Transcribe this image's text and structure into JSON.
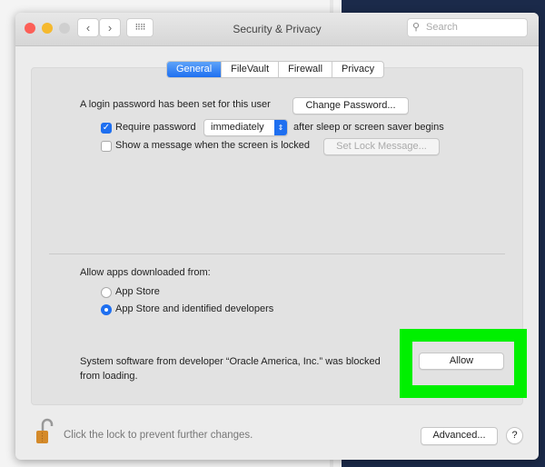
{
  "window": {
    "title": "Security & Privacy",
    "search_placeholder": "Search"
  },
  "tabs": [
    {
      "label": "General",
      "active": true
    },
    {
      "label": "FileVault"
    },
    {
      "label": "Firewall"
    },
    {
      "label": "Privacy"
    }
  ],
  "general": {
    "login_text": "A login password has been set for this user",
    "change_password": "Change Password...",
    "require_password_label": "Require password",
    "require_password_checked": true,
    "require_password_delay": "immediately",
    "after_sleep_text": "after sleep or screen saver begins",
    "show_message_label": "Show a message when the screen is locked",
    "show_message_checked": false,
    "set_lock_message": "Set Lock Message...",
    "allow_apps_label": "Allow apps downloaded from:",
    "options": [
      {
        "label": "App Store",
        "selected": false
      },
      {
        "label": "App Store and identified developers",
        "selected": true
      }
    ],
    "blocked_line1": "System software from developer “Oracle America, Inc.” was blocked",
    "blocked_line2": "from loading.",
    "allow": "Allow"
  },
  "footer": {
    "lock_text": "Click the lock to prevent further changes.",
    "advanced": "Advanced...",
    "help": "?"
  },
  "colors": {
    "accent": "#1e6ff0",
    "highlight": "#00f000",
    "desktop": "#1b2a4a"
  }
}
